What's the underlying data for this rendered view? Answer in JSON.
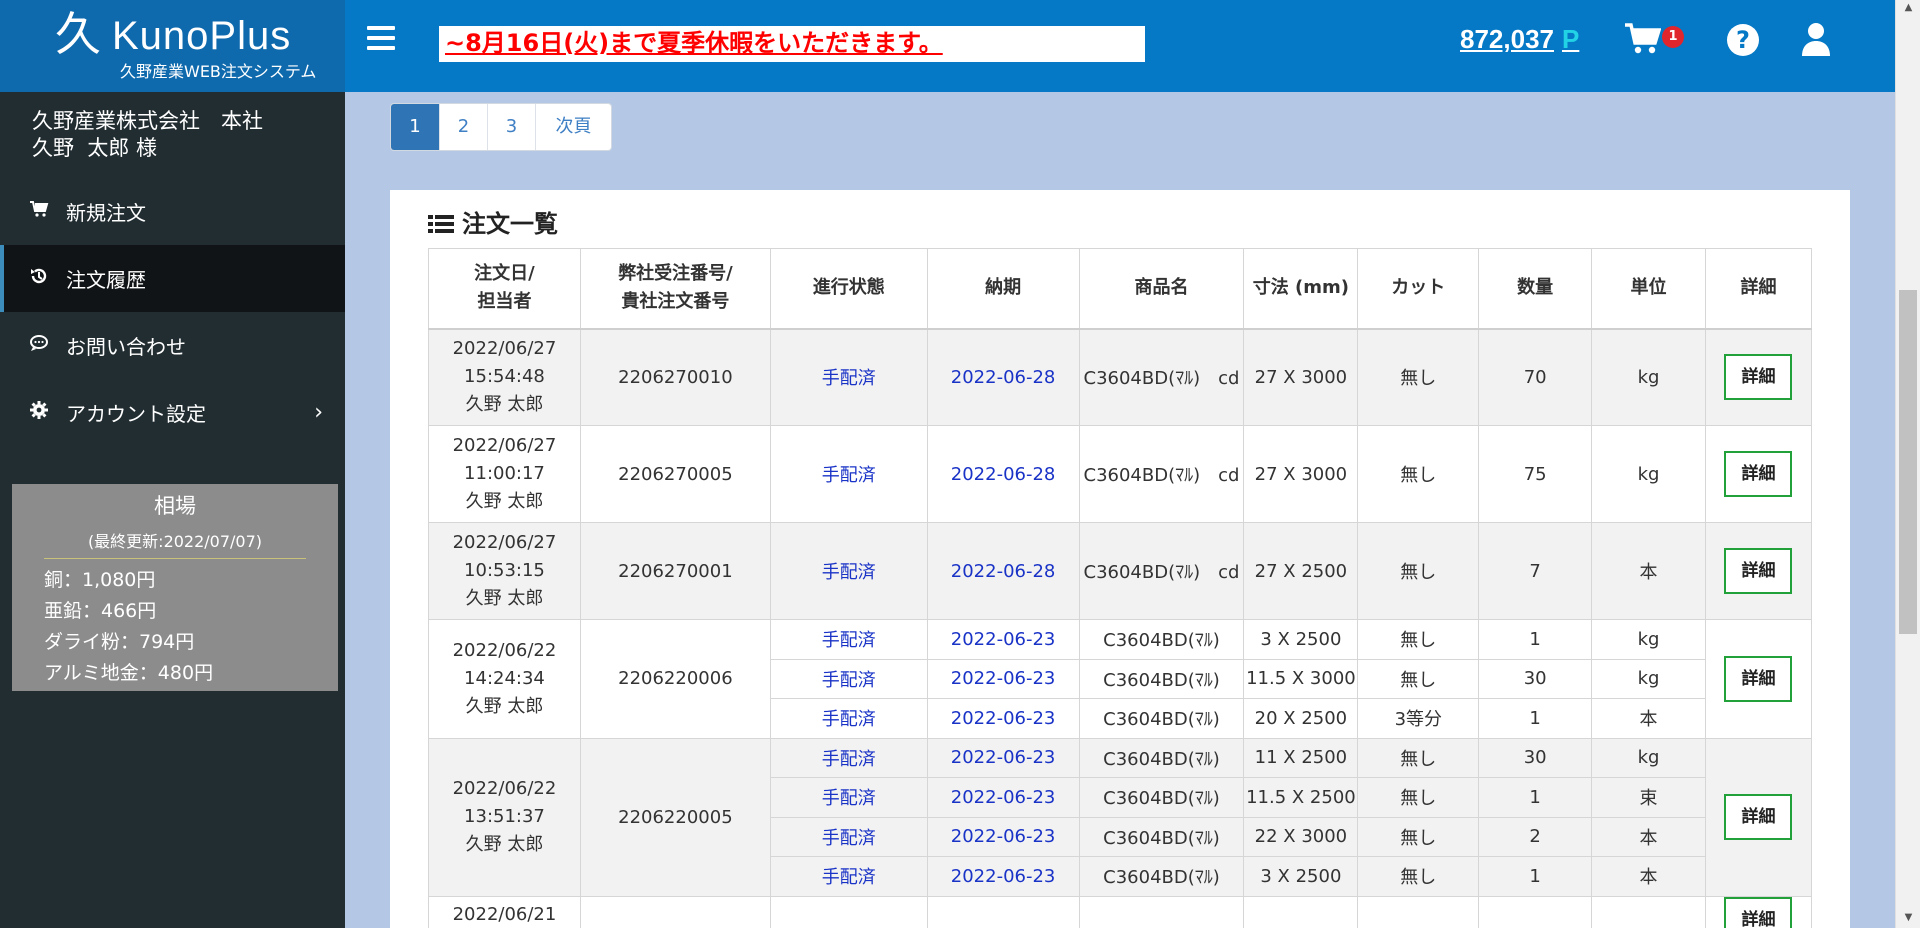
{
  "brand": {
    "name": "KunoPlus",
    "subtitle": "久野産業WEB注文システム",
    "mark": "久"
  },
  "user": {
    "company": "久野産業株式会社　本社",
    "name": "久野  太郎 様"
  },
  "menu": [
    {
      "label": "新規注文",
      "icon": "cart-icon"
    },
    {
      "label": "注文履歴",
      "icon": "history-icon"
    },
    {
      "label": "お問い合わせ",
      "icon": "chat-icon"
    },
    {
      "label": "アカウント設定",
      "icon": "gear-icon"
    }
  ],
  "market": {
    "title": "相場",
    "updated": "(最終更新:2022/07/07)",
    "rows": [
      "銅：1,080円",
      "亜鉛：466円",
      "ダライ粉：794円",
      "アルミ地金：480円"
    ]
  },
  "header": {
    "notice": "~8月16日(火)まで夏季休暇をいただきます。",
    "points": "872,037",
    "points_unit": "P",
    "cart_count": "1",
    "help": "?"
  },
  "pagination": {
    "pages": [
      "1",
      "2",
      "3"
    ],
    "next": "次頁"
  },
  "orders": {
    "title": "注文一覧",
    "headers": {
      "date": [
        "注文日/",
        "担当者"
      ],
      "number": [
        "弊社受注番号/",
        "貴社注文番号"
      ],
      "status": "進行状態",
      "due": "納期",
      "product": "商品名",
      "size": "寸法 (mm)",
      "cut": "カット",
      "qty": "数量",
      "unit": "単位",
      "detail": "詳細"
    },
    "detail_label": "詳細",
    "rows": [
      {
        "date": "2022/06/27",
        "time": "15:54:48",
        "person": "久野 太郎",
        "number": "2206270010",
        "items": [
          {
            "status": "手配済",
            "due": "2022-06-28",
            "product": "C3604BD(ﾏﾙ)　cd",
            "size": "27 X 3000",
            "cut": "無し",
            "qty": "70",
            "unit": "kg"
          }
        ]
      },
      {
        "date": "2022/06/27",
        "time": "11:00:17",
        "person": "久野 太郎",
        "number": "2206270005",
        "items": [
          {
            "status": "手配済",
            "due": "2022-06-28",
            "product": "C3604BD(ﾏﾙ)　cd",
            "size": "27 X 3000",
            "cut": "無し",
            "qty": "75",
            "unit": "kg"
          }
        ]
      },
      {
        "date": "2022/06/27",
        "time": "10:53:15",
        "person": "久野 太郎",
        "number": "2206270001",
        "items": [
          {
            "status": "手配済",
            "due": "2022-06-28",
            "product": "C3604BD(ﾏﾙ)　cd",
            "size": "27 X 2500",
            "cut": "無し",
            "qty": "7",
            "unit": "本"
          }
        ]
      },
      {
        "date": "2022/06/22",
        "time": "14:24:34",
        "person": "久野 太郎",
        "number": "2206220006",
        "items": [
          {
            "status": "手配済",
            "due": "2022-06-23",
            "product": "C3604BD(ﾏﾙ)",
            "size": "3 X 2500",
            "cut": "無し",
            "qty": "1",
            "unit": "kg"
          },
          {
            "status": "手配済",
            "due": "2022-06-23",
            "product": "C3604BD(ﾏﾙ)",
            "size": "11.5 X 3000",
            "cut": "無し",
            "qty": "30",
            "unit": "kg"
          },
          {
            "status": "手配済",
            "due": "2022-06-23",
            "product": "C3604BD(ﾏﾙ)",
            "size": "20 X 2500",
            "cut": "3等分",
            "qty": "1",
            "unit": "本"
          }
        ]
      },
      {
        "date": "2022/06/22",
        "time": "13:51:37",
        "person": "久野 太郎",
        "number": "2206220005",
        "items": [
          {
            "status": "手配済",
            "due": "2022-06-23",
            "product": "C3604BD(ﾏﾙ)",
            "size": "11 X 2500",
            "cut": "無し",
            "qty": "30",
            "unit": "kg"
          },
          {
            "status": "手配済",
            "due": "2022-06-23",
            "product": "C3604BD(ﾏﾙ)",
            "size": "11.5 X 2500",
            "cut": "無し",
            "qty": "1",
            "unit": "束"
          },
          {
            "status": "手配済",
            "due": "2022-06-23",
            "product": "C3604BD(ﾏﾙ)",
            "size": "22 X 3000",
            "cut": "無し",
            "qty": "2",
            "unit": "本"
          },
          {
            "status": "手配済",
            "due": "2022-06-23",
            "product": "C3604BD(ﾏﾙ)",
            "size": "3 X 2500",
            "cut": "無し",
            "qty": "1",
            "unit": "本"
          }
        ]
      },
      {
        "date": "2022/06/21",
        "time": "",
        "person": "",
        "number": "",
        "items": [
          {
            "status": "",
            "due": "",
            "product": "",
            "size": "",
            "cut": "",
            "qty": "",
            "unit": ""
          }
        ]
      }
    ]
  },
  "colors": {
    "sidebar": "#222d32",
    "header": "#0579c6",
    "brand": "#0f6aad",
    "background": "#b4c8e6",
    "notice": "#ff0000",
    "link": "#1a33c7",
    "detail_border": "#22a13a"
  }
}
